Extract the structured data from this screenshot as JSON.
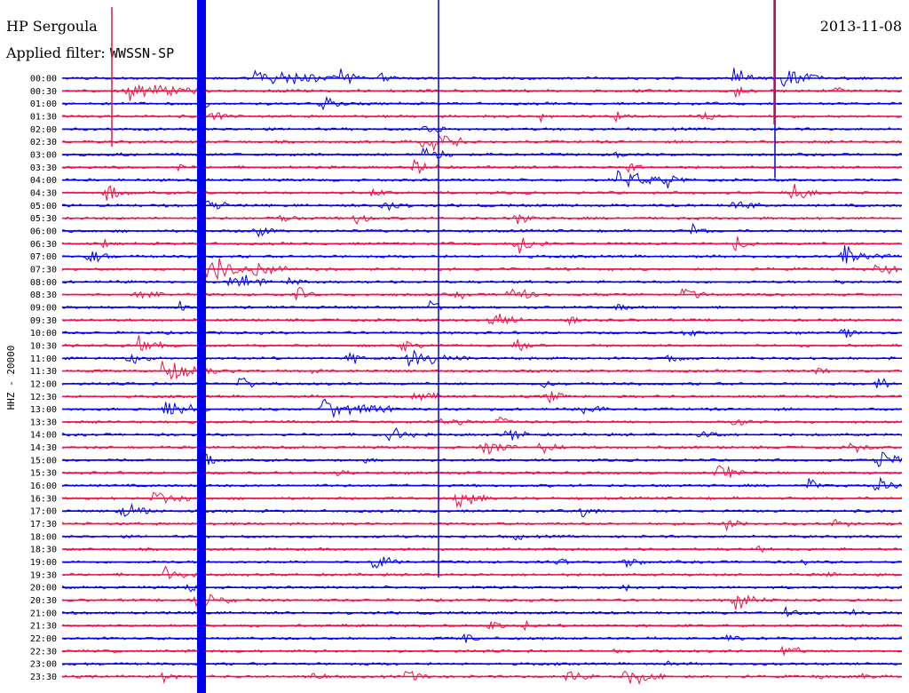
{
  "header": {
    "station": "HP Sergoula",
    "filter_label": "Applied filter:",
    "filter_value": "WWSSN-SP",
    "date": "2013-11-08"
  },
  "chart_data": {
    "type": "line",
    "title": "HP Sergoula",
    "subtitle": "Applied filter: WWSSN-SP",
    "date": "2013-11-08",
    "ylabel": "HHZ - 20000",
    "xlabel": "",
    "grid": false,
    "trace_colors": [
      "#0000ee",
      "#ee1144"
    ],
    "categories": [
      "00:00",
      "00:30",
      "01:00",
      "01:30",
      "02:00",
      "02:30",
      "03:00",
      "03:30",
      "04:00",
      "04:30",
      "05:00",
      "05:30",
      "06:00",
      "06:30",
      "07:00",
      "07:30",
      "08:00",
      "08:30",
      "09:00",
      "09:30",
      "10:00",
      "10:30",
      "11:00",
      "11:30",
      "12:00",
      "12:30",
      "13:00",
      "13:30",
      "14:00",
      "14:30",
      "15:00",
      "15:30",
      "16:00",
      "16:30",
      "17:00",
      "17:30",
      "18:00",
      "18:30",
      "19:00",
      "19:30",
      "20:00",
      "20:30",
      "21:00",
      "21:30",
      "22:00",
      "22:30",
      "23:00",
      "23:30"
    ],
    "events": [
      [
        0.23,
        1,
        60
      ],
      [
        0.33,
        0.8,
        14
      ],
      [
        0.38,
        0.6,
        8
      ],
      [
        0.8,
        1,
        14
      ],
      [
        0.86,
        1,
        22
      ],
      [
        0.08,
        0.9,
        45
      ],
      [
        0.8,
        0.7,
        14
      ],
      [
        0.92,
        0.4,
        8
      ],
      [
        0.31,
        0.8,
        14
      ],
      [
        0.17,
        0.5,
        8
      ],
      [
        0.18,
        0.7,
        14
      ],
      [
        0.57,
        0.4,
        8
      ],
      [
        0.66,
        0.6,
        10
      ],
      [
        0.76,
        0.7,
        12
      ],
      [
        0.43,
        0.8,
        14
      ],
      [
        0.43,
        1,
        30
      ],
      [
        0.07,
        0.4,
        6
      ],
      [
        0.66,
        0.5,
        8
      ],
      [
        0.43,
        1,
        18
      ],
      [
        0.14,
        0.4,
        6
      ],
      [
        0.67,
        0.6,
        10
      ],
      [
        0.42,
        1,
        14
      ],
      [
        0.66,
        1,
        40
      ],
      [
        0.72,
        0.5,
        8
      ],
      [
        0.87,
        0.8,
        16
      ],
      [
        0.37,
        0.5,
        10
      ],
      [
        0.05,
        0.9,
        18
      ],
      [
        0.17,
        0.8,
        14
      ],
      [
        0.38,
        0.7,
        16
      ],
      [
        0.8,
        0.8,
        16
      ],
      [
        0.26,
        0.7,
        14
      ],
      [
        0.35,
        0.6,
        10
      ],
      [
        0.54,
        0.8,
        12
      ],
      [
        0.75,
        0.6,
        10
      ],
      [
        0.23,
        0.8,
        12
      ],
      [
        0.54,
        1,
        20
      ],
      [
        0.8,
        0.8,
        12
      ],
      [
        0.05,
        0.4,
        6
      ],
      [
        0.93,
        1,
        28
      ],
      [
        0.03,
        0.7,
        14
      ],
      [
        0.18,
        0.8,
        14
      ],
      [
        0.97,
        1,
        12
      ],
      [
        0.17,
        1,
        30
      ],
      [
        0.23,
        1,
        20
      ],
      [
        0.21,
        0.8,
        18
      ],
      [
        0.27,
        0.6,
        10
      ],
      [
        0.2,
        0.4,
        6
      ],
      [
        0.92,
        0.3,
        6
      ],
      [
        0.47,
        0.5,
        8
      ],
      [
        0.09,
        0.8,
        14
      ],
      [
        0.53,
        1,
        18
      ],
      [
        0.74,
        0.9,
        14
      ],
      [
        0.28,
        0.8,
        10
      ],
      [
        0.44,
        0.5,
        8
      ],
      [
        0.14,
        0.6,
        14
      ],
      [
        0.66,
        0.4,
        8
      ],
      [
        0.44,
        0.4,
        6
      ],
      [
        0.51,
        1,
        22
      ],
      [
        0.6,
        0.5,
        10
      ],
      [
        0.93,
        0.5,
        10
      ],
      [
        0.74,
        0.6,
        12
      ],
      [
        0.09,
        1,
        14
      ],
      [
        0.4,
        0.7,
        14
      ],
      [
        0.54,
        0.7,
        10
      ],
      [
        0.41,
        1,
        36
      ],
      [
        0.08,
        0.8,
        14
      ],
      [
        0.34,
        0.7,
        10
      ],
      [
        0.72,
        0.6,
        10
      ],
      [
        0.9,
        0.5,
        8
      ],
      [
        0.12,
        1,
        40
      ],
      [
        0.3,
        0.5,
        8
      ],
      [
        0.57,
        0.5,
        8
      ],
      [
        0.97,
        1,
        10
      ],
      [
        0.21,
        0.8,
        12
      ],
      [
        0.42,
        0.8,
        14
      ],
      [
        0.58,
        0.6,
        12
      ],
      [
        0.62,
        0.8,
        16
      ],
      [
        0.12,
        1,
        30
      ],
      [
        0.31,
        1,
        40
      ],
      [
        0.45,
        0.8,
        18
      ],
      [
        0.52,
        0.6,
        10
      ],
      [
        0.8,
        0.6,
        10
      ],
      [
        0.39,
        0.8,
        14
      ],
      [
        0.53,
        0.8,
        14
      ],
      [
        0.76,
        0.5,
        12
      ],
      [
        0.94,
        0.6,
        12
      ],
      [
        0.5,
        1,
        20
      ],
      [
        0.57,
        0.8,
        14
      ],
      [
        0.97,
        1,
        20
      ],
      [
        0.36,
        0.4,
        6
      ],
      [
        0.17,
        0.6,
        14
      ],
      [
        0.78,
        1,
        16
      ],
      [
        0.33,
        0.5,
        8
      ],
      [
        0.89,
        0.7,
        12
      ],
      [
        0.97,
        1,
        12
      ],
      [
        0.11,
        0.8,
        20
      ],
      [
        0.47,
        1,
        20
      ],
      [
        0.62,
        0.6,
        10
      ],
      [
        0.07,
        1,
        18
      ],
      [
        0.79,
        0.6,
        12
      ],
      [
        0.92,
        0.5,
        10
      ],
      [
        0.54,
        0.4,
        6
      ],
      [
        0.83,
        0.4,
        6
      ],
      [
        0.67,
        0.8,
        12
      ],
      [
        0.88,
        0.4,
        6
      ],
      [
        0.37,
        0.8,
        18
      ],
      [
        0.59,
        0.5,
        8
      ],
      [
        0.16,
        0.4,
        6
      ],
      [
        0.91,
        0.4,
        6
      ],
      [
        0.12,
        0.8,
        14
      ],
      [
        0.67,
        0.4,
        6
      ],
      [
        0.15,
        0.7,
        10
      ],
      [
        0.16,
        1,
        22
      ],
      [
        0.8,
        1,
        18
      ],
      [
        0.86,
        0.6,
        10
      ],
      [
        0.94,
        0.7,
        12
      ],
      [
        0.51,
        0.7,
        10
      ],
      [
        0.55,
        0.5,
        8
      ],
      [
        0.79,
        0.5,
        10
      ],
      [
        0.48,
        0.5,
        8
      ],
      [
        0.66,
        0.4,
        6
      ],
      [
        0.86,
        0.7,
        14
      ],
      [
        0.72,
        0.3,
        6
      ],
      [
        0.6,
        0.8,
        16
      ],
      [
        0.95,
        0.5,
        8
      ],
      [
        0.41,
        0.7,
        16
      ],
      [
        0.12,
        0.5,
        8
      ],
      [
        0.3,
        0.6,
        10
      ],
      [
        0.67,
        1,
        24
      ],
      [
        0.9,
        0.3,
        6
      ]
    ]
  }
}
